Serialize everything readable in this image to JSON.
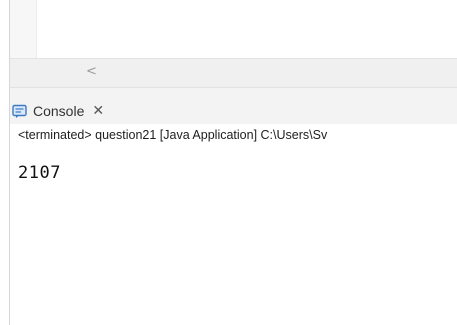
{
  "editor": {
    "scroll_left_arrow": "<"
  },
  "console": {
    "tab_label": "Console",
    "close_glyph": "✕",
    "status_line": "<terminated> question21 [Java Application] C:\\Users\\Sv",
    "output": "2107"
  },
  "icons": {
    "console": "console-icon",
    "close": "close-icon",
    "scroll_left": "chevron-left-icon"
  },
  "colors": {
    "console_icon_blue": "#3d7ac5",
    "console_icon_fill": "#dbe8f7"
  }
}
